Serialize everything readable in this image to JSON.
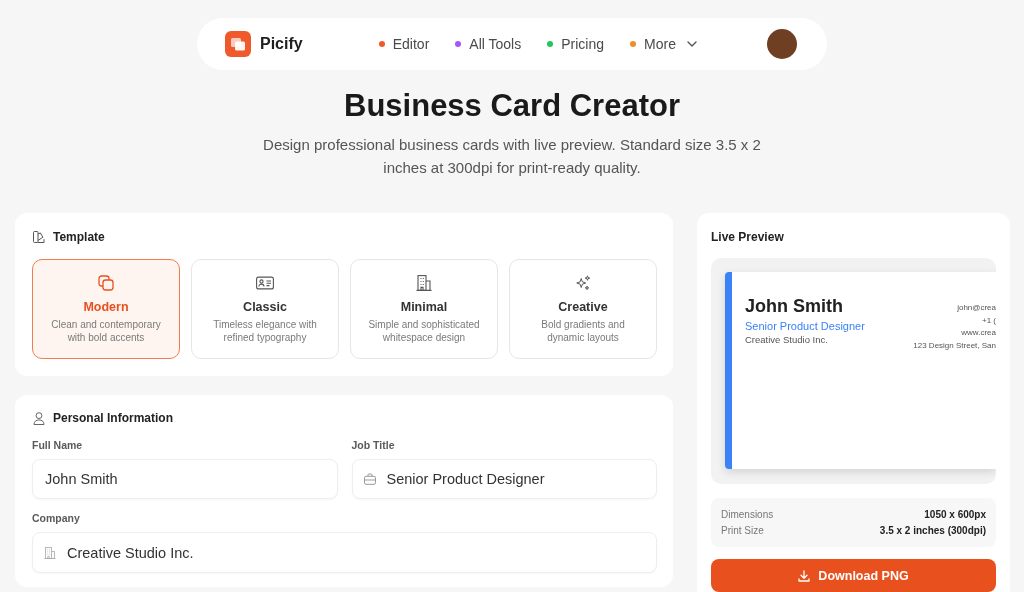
{
  "nav": {
    "brand": "Picify",
    "links": [
      {
        "label": "Editor",
        "color": "#f0592b",
        "kind": "link"
      },
      {
        "label": "All Tools",
        "color": "#a855f7",
        "kind": "link"
      },
      {
        "label": "Pricing",
        "color": "#22c55e",
        "kind": "link"
      },
      {
        "label": "More",
        "color": "#f28a2e",
        "kind": "menu"
      }
    ]
  },
  "header": {
    "title": "Business Card Creator",
    "subtitle": "Design professional business cards with live preview. Standard size 3.5 x 2 inches at 300dpi for print-ready quality."
  },
  "template_panel": {
    "heading": "Template",
    "options": [
      {
        "name": "Modern",
        "description": "Clean and contemporary with bold accents",
        "selected": true
      },
      {
        "name": "Classic",
        "description": "Timeless elegance with refined typography",
        "selected": false
      },
      {
        "name": "Minimal",
        "description": "Simple and sophisticated whitespace design",
        "selected": false
      },
      {
        "name": "Creative",
        "description": "Bold gradients and dynamic layouts",
        "selected": false
      }
    ]
  },
  "personal_panel": {
    "heading": "Personal Information",
    "fields": [
      {
        "label": "Full Name",
        "value": "John Smith",
        "kind": "name"
      },
      {
        "label": "Job Title",
        "value": "Senior Product Designer",
        "kind": "job"
      },
      {
        "label": "Company",
        "value": "Creative Studio Inc.",
        "kind": "company"
      }
    ]
  },
  "preview_panel": {
    "heading": "Live Preview",
    "card": {
      "name": "John Smith",
      "job_title": "Senior Product Designer",
      "company": "Creative Studio Inc.",
      "contacts": [
        "john@crea",
        "+1 (",
        "www.crea",
        "123 Design Street, San"
      ]
    },
    "specs": [
      {
        "label": "Dimensions",
        "value": "1050 x 600px"
      },
      {
        "label": "Print Size",
        "value": "3.5 x 2 inches (300dpi)"
      }
    ],
    "download_button": "Download PNG"
  }
}
